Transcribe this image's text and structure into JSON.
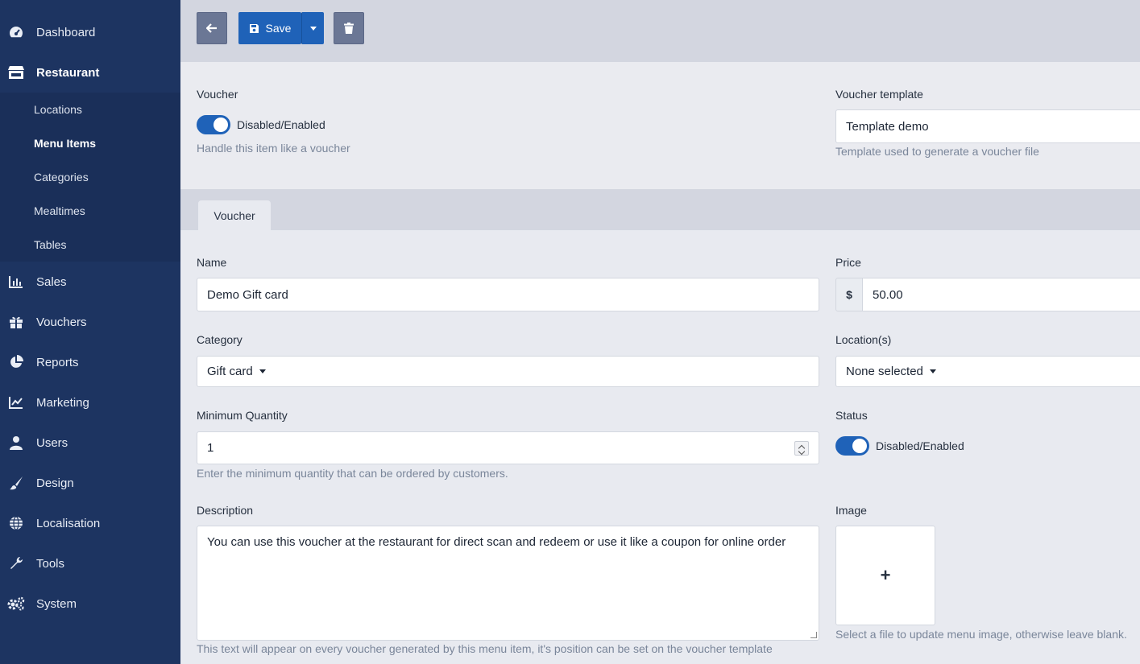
{
  "sidebar": {
    "items": [
      {
        "label": "Dashboard",
        "icon": "speedometer-icon"
      },
      {
        "label": "Restaurant",
        "icon": "store-icon"
      },
      {
        "label": "Sales",
        "icon": "bar-chart-icon"
      },
      {
        "label": "Vouchers",
        "icon": "gift-icon"
      },
      {
        "label": "Reports",
        "icon": "pie-chart-icon"
      },
      {
        "label": "Marketing",
        "icon": "line-chart-icon"
      },
      {
        "label": "Users",
        "icon": "user-icon"
      },
      {
        "label": "Design",
        "icon": "paintbrush-icon"
      },
      {
        "label": "Localisation",
        "icon": "globe-icon"
      },
      {
        "label": "Tools",
        "icon": "wrench-icon"
      },
      {
        "label": "System",
        "icon": "cogs-icon"
      }
    ],
    "subitems": [
      "Locations",
      "Menu Items",
      "Categories",
      "Mealtimes",
      "Tables"
    ]
  },
  "toolbar": {
    "save_label": "Save"
  },
  "voucher": {
    "label": "Voucher",
    "toggle_label": "Disabled/Enabled",
    "toggle_on": true,
    "help": "Handle this item like a voucher"
  },
  "voucher_template": {
    "label": "Voucher template",
    "value": "Template demo",
    "help": "Template used to generate a voucher file"
  },
  "tabs": [
    {
      "label": "Voucher"
    }
  ],
  "form": {
    "name": {
      "label": "Name",
      "value": "Demo Gift card"
    },
    "price": {
      "label": "Price",
      "currency": "$",
      "value": "50.00"
    },
    "category": {
      "label": "Category",
      "value": "Gift card"
    },
    "locations": {
      "label": "Location(s)",
      "value": "None selected"
    },
    "min_qty": {
      "label": "Minimum Quantity",
      "value": "1",
      "help": "Enter the minimum quantity that can be ordered by customers."
    },
    "status": {
      "label": "Status",
      "toggle_label": "Disabled/Enabled",
      "toggle_on": true
    },
    "description": {
      "label": "Description",
      "value": "You can use this voucher at the restaurant for direct scan and redeem or use it like a coupon for online order",
      "help": "This text will appear on every voucher generated by this menu item, it's position can be set on the voucher template"
    },
    "image": {
      "label": "Image",
      "add_symbol": "+",
      "help": "Select a file to update menu image, otherwise leave blank."
    }
  },
  "colors": {
    "sidebar": "#1d3461",
    "primary": "#1f62b8",
    "secondary": "#6b7795"
  }
}
